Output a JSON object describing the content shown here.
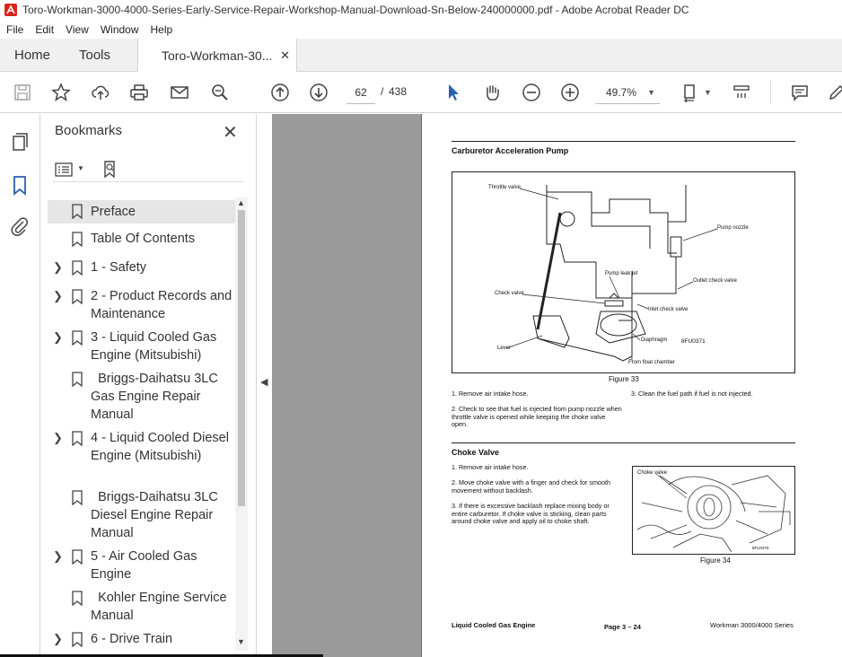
{
  "window": {
    "title": "Toro-Workman-3000-4000-Series-Early-Service-Repair-Workshop-Manual-Download-Sn-Below-240000000.pdf - Adobe Acrobat Reader DC"
  },
  "menu": {
    "items": [
      "File",
      "Edit",
      "View",
      "Window",
      "Help"
    ]
  },
  "tabs": {
    "home": "Home",
    "tools": "Tools",
    "document": "Toro-Workman-30...",
    "close": "✕"
  },
  "toolbar": {
    "page_current": "62",
    "page_sep": "/",
    "page_total": "438",
    "zoom": "49.7%"
  },
  "bookmarks": {
    "header": "Bookmarks",
    "close": "✕",
    "items": [
      {
        "label": "Preface",
        "expandable": false,
        "selected": true
      },
      {
        "label": "Table Of Contents",
        "expandable": false
      },
      {
        "label": "1 - Safety",
        "expandable": true
      },
      {
        "label": "2 - Product Records and Maintenance",
        "expandable": true
      },
      {
        "label": "3 - Liquid Cooled Gas Engine (Mitsubishi)",
        "expandable": true
      },
      {
        "label": "  Briggs-Daihatsu 3LC Gas Engine Repair Manual",
        "expandable": false
      },
      {
        "label": "4 - Liquid Cooled Diesel Engine (Mitsubishi)",
        "expandable": true
      },
      {
        "label": "  Briggs-Daihatsu 3LC Diesel Engine Repair Manual",
        "expandable": false
      },
      {
        "label": "5 - Air Cooled Gas Engine",
        "expandable": true
      },
      {
        "label": "  Kohler Engine Service Manual",
        "expandable": false
      },
      {
        "label": "6 - Drive Train",
        "expandable": true
      }
    ]
  },
  "pdf_page": {
    "section1_title": "Carburetor Acceleration Pump",
    "fig33_labels": {
      "throttle_valve": "Throttle valve",
      "pump_nozzle": "Pump nozzle",
      "pump_leak_jet": "Pump leak jet",
      "check_valve": "Check valve",
      "outlet_check_valve": "Outlet check valve",
      "inlet_check_valve": "Inlet check valve",
      "diaphragm": "Diaphragm",
      "lever": "Lever",
      "from_float_chamber": "From float chamber",
      "code": "8FU0371"
    },
    "fig33_caption": "Figure 33",
    "step1": "1. Remove air intake hose.",
    "step2": "2. Check to see that fuel is injected from pump nozzle when throttle valve is opened while keeping the choke valve open.",
    "step3": "3. Clean the fuel path if fuel is not injected.",
    "section2_title": "Choke Valve",
    "choke_step1": "1. Remove air intake hose.",
    "choke_step2": "2. Move choke valve with a finger and check for smooth movement without backlash.",
    "choke_step3": "3. If there is excessive backlash replace mixing body or entire carburetor. If choke valve is sticking, clean parts around choke valve and apply oil to choke shaft.",
    "fig34_label": "Choke valve",
    "fig34_code": "8FU0376",
    "fig34_caption": "Figure 34",
    "footer_left": "Liquid Cooled Gas Engine",
    "footer_center": "Page 3 – 24",
    "footer_right": "Workman 3000/4000 Series"
  },
  "colors": {
    "accent_blue": "#2b5fb4",
    "doc_background": "#9a9a9a"
  }
}
